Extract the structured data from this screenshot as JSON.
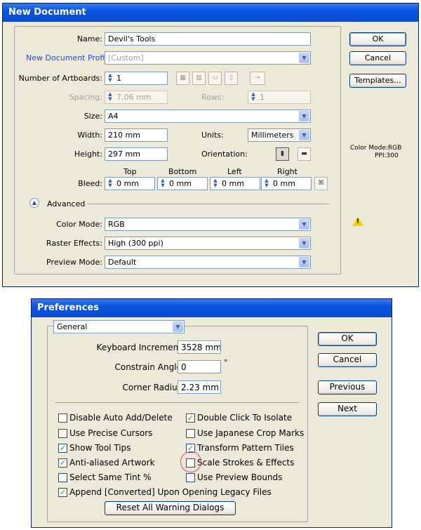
{
  "new_document": {
    "title": "New Document",
    "name_label": "Name:",
    "name_value": "Devil's Tools",
    "profile_label": "New Document Profile:",
    "profile_value": "[Custom]",
    "artboards_label": "Number of Artboards:",
    "artboards_value": "1",
    "spacing_label": "Spacing:",
    "spacing_value": "7.06 mm",
    "rows_label": "Rows:",
    "rows_value": "1",
    "size_label": "Size:",
    "size_value": "A4",
    "width_label": "Width:",
    "width_value": "210 mm",
    "units_label": "Units:",
    "units_value": "Millimeters",
    "height_label": "Height:",
    "height_value": "297 mm",
    "orientation_label": "Orientation:",
    "bleed_label": "Bleed:",
    "bleed_top_label": "Top",
    "bleed_bottom_label": "Bottom",
    "bleed_left_label": "Left",
    "bleed_right_label": "Right",
    "bleed_top": "0 mm",
    "bleed_bottom": "0 mm",
    "bleed_left": "0 mm",
    "bleed_right": "0 mm",
    "advanced_label": "Advanced",
    "color_mode_label": "Color Mode:",
    "color_mode_value": "RGB",
    "raster_label": "Raster Effects:",
    "raster_value": "High (300 ppi)",
    "preview_label": "Preview Mode:",
    "preview_value": "Default",
    "ok": "OK",
    "cancel": "Cancel",
    "templates": "Templates...",
    "info_color": "Color Mode:RGB",
    "info_ppi": "PPI:300"
  },
  "preferences": {
    "title": "Preferences",
    "section": "General",
    "keyboard_label": "Keyboard Increment:",
    "keyboard_value": "3528 mm",
    "angle_label": "Constrain Angle:",
    "angle_value": "0",
    "angle_unit": "°",
    "radius_label": "Corner Radius:",
    "radius_value": "2.23 mm",
    "ok": "OK",
    "cancel": "Cancel",
    "previous": "Previous",
    "next": "Next",
    "checkboxes": [
      {
        "label": "Disable Auto Add/Delete",
        "checked": false
      },
      {
        "label": "Double Click To Isolate",
        "checked": true
      },
      {
        "label": "Use Precise Cursors",
        "checked": false
      },
      {
        "label": "Use Japanese Crop Marks",
        "checked": false
      },
      {
        "label": "Show Tool Tips",
        "checked": true
      },
      {
        "label": "Transform Pattern Tiles",
        "checked": true
      },
      {
        "label": "Anti-aliased Artwork",
        "checked": true
      },
      {
        "label": "Scale Strokes & Effects",
        "checked": false
      },
      {
        "label": "Select Same Tint %",
        "checked": false
      },
      {
        "label": "Use Preview Bounds",
        "checked": false
      },
      {
        "label": "Append [Converted] Upon Opening Legacy Files",
        "checked": true
      }
    ],
    "reset_button": "Reset All Warning Dialogs"
  },
  "colors": {
    "accent": "#0a4bd0",
    "highlight_circle": "#e0457a",
    "check": "#21a121"
  }
}
